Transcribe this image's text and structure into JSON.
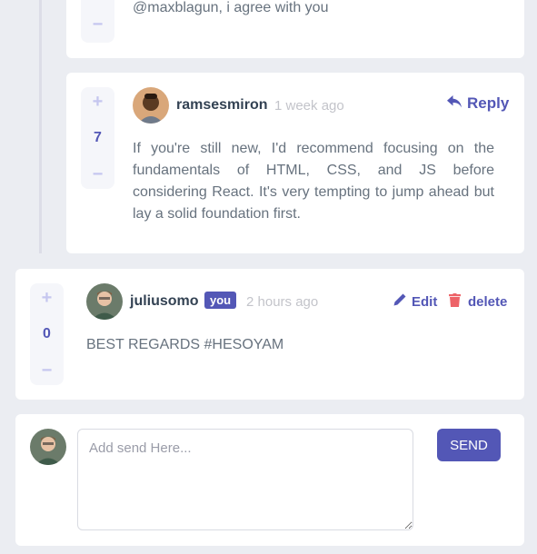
{
  "comments": [
    {
      "text": "@maxblagun, i agree with you"
    },
    {
      "username": "ramsesmiron",
      "timestamp": "1 week ago",
      "score": "7",
      "reply_label": "Reply",
      "text": "If you're still new, I'd recommend focusing on the fundamentals of HTML, CSS, and JS before considering React. It's very tempting to jump ahead but lay a solid foundation first."
    },
    {
      "username": "juliusomo",
      "badge": "you",
      "timestamp": "2 hours ago",
      "score": "0",
      "edit_label": "Edit",
      "delete_label": "delete",
      "text": "BEST REGARDS #HESOYAM"
    }
  ],
  "composer": {
    "placeholder": "Add send Here...",
    "send_label": "SEND"
  },
  "vote": {
    "plus": "+",
    "minus": "−"
  },
  "colors": {
    "accent": "#5357b6",
    "danger": "#ed6368",
    "background": "#ebedf2",
    "card": "#ffffff"
  }
}
